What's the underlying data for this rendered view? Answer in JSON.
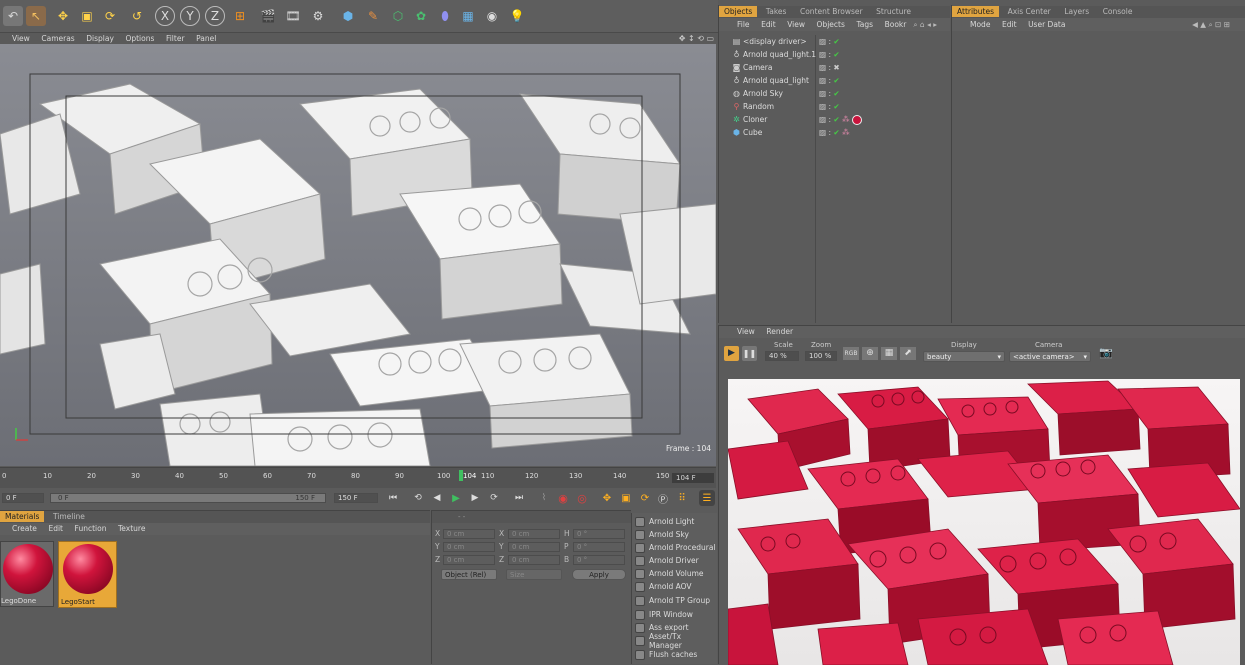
{
  "viewport": {
    "menu": [
      "View",
      "Cameras",
      "Display",
      "Options",
      "Filter",
      "Panel"
    ],
    "frame_label": "Frame : 104"
  },
  "timeline": {
    "ticks": [
      "0",
      "10",
      "20",
      "30",
      "40",
      "50",
      "60",
      "70",
      "80",
      "90",
      "100",
      "110",
      "120",
      "130",
      "140",
      "150"
    ],
    "current_frame": "104",
    "current_frame_box": "104 F",
    "start_frame": "0 F",
    "range_start": "0 F",
    "range_end": "150 F",
    "end_frame": "150 F"
  },
  "objects_panel": {
    "tabs": [
      "Objects",
      "Takes",
      "Content Browser",
      "Structure"
    ],
    "menu": [
      "File",
      "Edit",
      "View",
      "Objects",
      "Tags",
      "Bookr"
    ],
    "items": [
      {
        "name": "<display driver>",
        "icon": "document-icon"
      },
      {
        "name": "Arnold quad_light.1",
        "icon": "lightbulb-icon"
      },
      {
        "name": "Camera",
        "icon": "camera-icon"
      },
      {
        "name": "Arnold quad_light",
        "icon": "lightbulb-icon"
      },
      {
        "name": "Arnold Sky",
        "icon": "sky-icon"
      },
      {
        "name": "Random",
        "icon": "random-icon"
      },
      {
        "name": "Cloner",
        "icon": "cloner-icon"
      },
      {
        "name": "Cube",
        "icon": "cube-icon"
      }
    ]
  },
  "attributes_panel": {
    "tabs": [
      "Attributes",
      "Axis Center",
      "Layers",
      "Console"
    ],
    "menu": [
      "Mode",
      "Edit",
      "User Data"
    ]
  },
  "ipr_panel": {
    "menu": [
      "View",
      "Render"
    ],
    "scale_label": "Scale",
    "scale_value": "40 %",
    "zoom_label": "Zoom",
    "zoom_value": "100 %",
    "display_label": "Display",
    "display_value": "beauty",
    "camera_label": "Camera",
    "camera_value": "<active camera>",
    "rgb_label": "RGB"
  },
  "materials_panel": {
    "tabs": [
      "Materials",
      "Timeline"
    ],
    "menu": [
      "Create",
      "Edit",
      "Function",
      "Texture"
    ],
    "items": [
      {
        "name": "LegoDone",
        "selected": false
      },
      {
        "name": "LegoStart",
        "selected": true
      }
    ]
  },
  "coordinates_panel": {
    "rows": [
      {
        "a": "X",
        "av": "0 cm",
        "b": "X",
        "bv": "0 cm",
        "c": "H",
        "cv": "0 °"
      },
      {
        "a": "Y",
        "av": "0 cm",
        "b": "Y",
        "bv": "0 cm",
        "c": "P",
        "cv": "0 °"
      },
      {
        "a": "Z",
        "av": "0 cm",
        "b": "Z",
        "bv": "0 cm",
        "c": "B",
        "cv": "0 °"
      }
    ],
    "mode": "Object (Rel)",
    "size": "Size",
    "apply": "Apply"
  },
  "arnold_menu": {
    "items": [
      "Arnold Light",
      "Arnold Sky",
      "Arnold Procedural",
      "Arnold Driver",
      "Arnold Volume",
      "Arnold AOV",
      "Arnold TP Group",
      "IPR Window",
      "Ass export",
      "Asset/Tx Manager",
      "Flush caches"
    ]
  },
  "colors": {
    "accent": "#e0a440",
    "lego_red": "#c8143c",
    "panel": "#5b5b5b",
    "viewport_bg": "#7a7d85"
  }
}
